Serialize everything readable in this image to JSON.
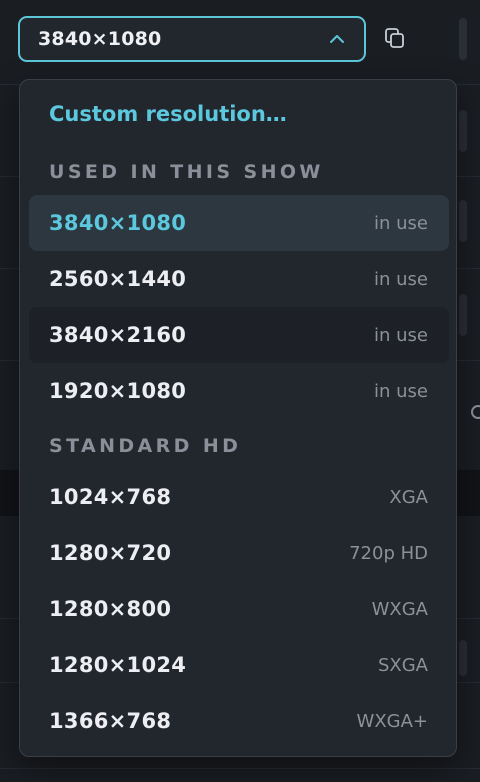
{
  "select": {
    "value": "3840×1080",
    "expanded": true
  },
  "dropdown": {
    "custom_label": "Custom resolution…",
    "sections": [
      {
        "title": "USED IN THIS SHOW",
        "options": [
          {
            "label": "3840×1080",
            "meta": "in use",
            "selected": true
          },
          {
            "label": "2560×1440",
            "meta": "in use"
          },
          {
            "label": "3840×2160",
            "meta": "in use",
            "hovered": true
          },
          {
            "label": "1920×1080",
            "meta": "in use"
          }
        ]
      },
      {
        "title": "STANDARD HD",
        "options": [
          {
            "label": "1024×768",
            "meta": "XGA"
          },
          {
            "label": "1280×720",
            "meta": "720p HD"
          },
          {
            "label": "1280×800",
            "meta": "WXGA"
          },
          {
            "label": "1280×1024",
            "meta": "SXGA"
          },
          {
            "label": "1366×768",
            "meta": "WXGA+"
          }
        ]
      }
    ]
  },
  "icons": {
    "chevron": "chevron-up-icon",
    "copy": "copy-icon"
  },
  "colors": {
    "accent": "#5cc8de",
    "panel": "#22262d",
    "background": "#1a1d22"
  }
}
